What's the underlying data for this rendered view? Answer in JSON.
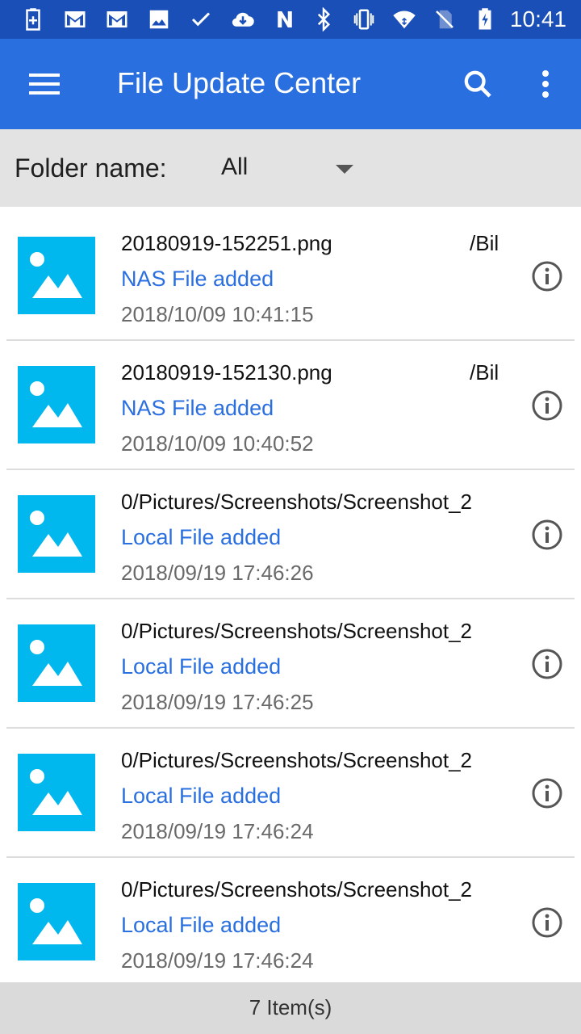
{
  "status_bar": {
    "time": "10:41",
    "left_icons": [
      "battery-saver-icon",
      "gmail-icon",
      "gmail-icon",
      "image-icon",
      "check-icon",
      "cloud-download-icon",
      "n-app-icon"
    ],
    "right_icons": [
      "bluetooth-icon",
      "vibrate-icon",
      "wifi-icon",
      "no-sim-icon",
      "battery-charging-icon"
    ]
  },
  "app_bar": {
    "title": "File Update Center",
    "color": "#2a6fe0"
  },
  "filter": {
    "label": "Folder name:",
    "selected": "All"
  },
  "items": [
    {
      "path": "20180919-152251.png",
      "path_suffix": "/Bil",
      "status": "NAS File added",
      "timestamp": "2018/10/09 10:41:15"
    },
    {
      "path": "20180919-152130.png",
      "path_suffix": "/Bil",
      "status": "NAS File added",
      "timestamp": "2018/10/09 10:40:52"
    },
    {
      "path": "0/Pictures/Screenshots/Screenshot_2",
      "path_suffix": "",
      "status": "Local File added",
      "timestamp": "2018/09/19 17:46:26"
    },
    {
      "path": "0/Pictures/Screenshots/Screenshot_2",
      "path_suffix": "",
      "status": "Local File added",
      "timestamp": "2018/09/19 17:46:25"
    },
    {
      "path": "0/Pictures/Screenshots/Screenshot_2",
      "path_suffix": "",
      "status": "Local File added",
      "timestamp": "2018/09/19 17:46:24"
    },
    {
      "path": "0/Pictures/Screenshots/Screenshot_2",
      "path_suffix": "",
      "status": "Local File added",
      "timestamp": "2018/09/19 17:46:24"
    }
  ],
  "footer": {
    "count_label": "7 Item(s)"
  },
  "colors": {
    "accent": "#2a6fe0",
    "status_bar": "#1b4fb8",
    "thumbnail": "#00b7ee"
  }
}
